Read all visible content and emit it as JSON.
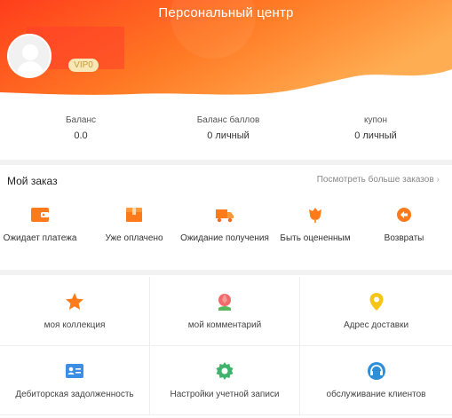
{
  "header": {
    "title": "Персональный центр",
    "vip": "VIP0"
  },
  "stats": [
    {
      "label": "Баланс",
      "value": "0.0"
    },
    {
      "label": "Баланс баллов",
      "value": "0 личный"
    },
    {
      "label": "купон",
      "value": "0 личный"
    }
  ],
  "orders": {
    "title": "Мой заказ",
    "more": "Посмотреть больше заказов",
    "items": [
      {
        "label": "Ожидает платежа",
        "icon": "wallet-icon"
      },
      {
        "label": "Уже оплачено",
        "icon": "box-icon"
      },
      {
        "label": "Ожидание получения",
        "icon": "truck-icon"
      },
      {
        "label": "Быть оцененным",
        "icon": "flower-icon"
      },
      {
        "label": "Возвраты",
        "icon": "return-icon"
      }
    ]
  },
  "grid": [
    {
      "label": "моя коллекция",
      "icon": "star-icon"
    },
    {
      "label": "мой комментарий",
      "icon": "tulip-icon"
    },
    {
      "label": "Адрес доставки",
      "icon": "location-pin-icon"
    },
    {
      "label": "Дебиторская задолженность",
      "icon": "id-card-icon"
    },
    {
      "label": "Настройки учетной записи",
      "icon": "gear-icon"
    },
    {
      "label": "обслуживание клиентов",
      "icon": "headset-icon"
    }
  ],
  "colors": {
    "accent": "#ff6a1a",
    "header_start": "#ff4d1f",
    "header_end": "#ffa64a"
  }
}
